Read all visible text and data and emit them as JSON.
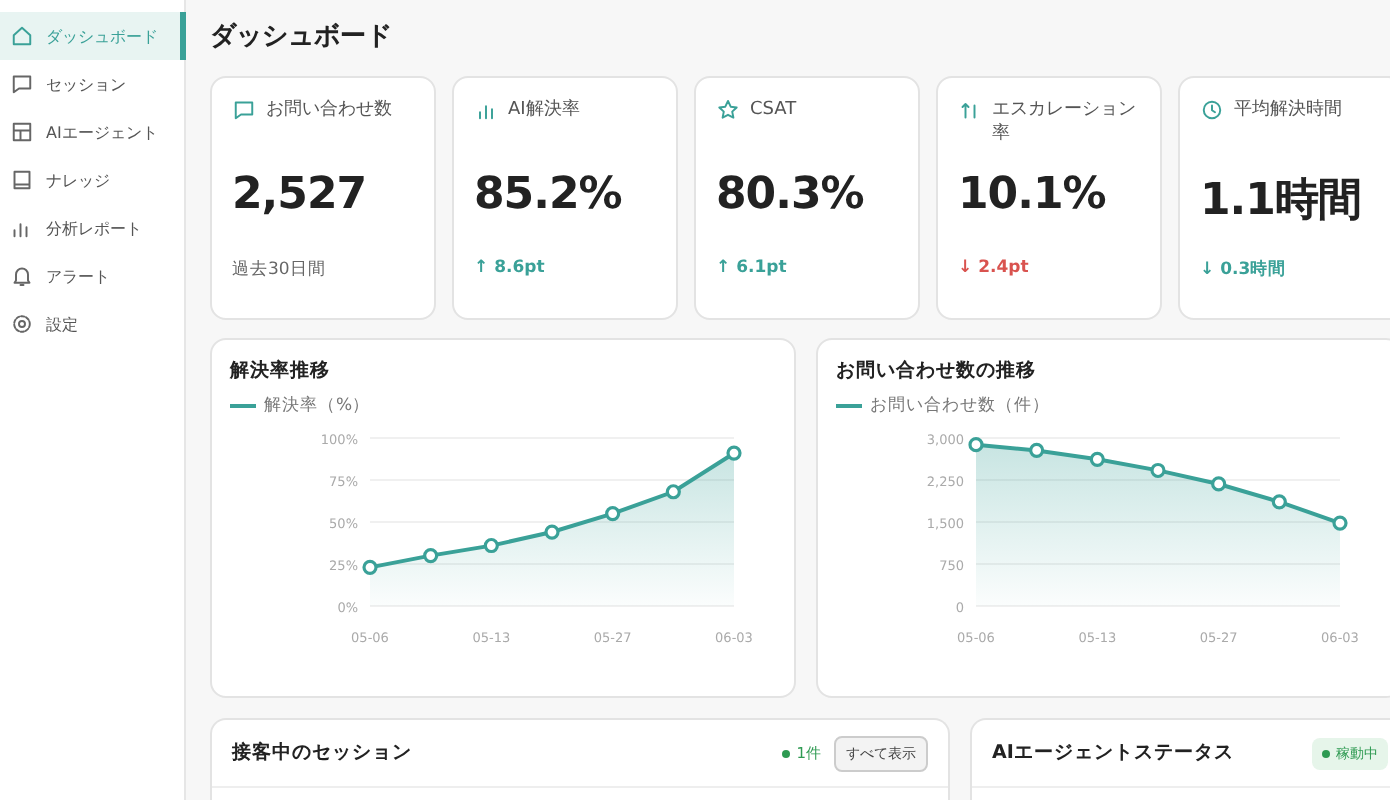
{
  "sidebar": {
    "items": [
      {
        "label": "ダッシュボード",
        "selected": true
      },
      {
        "label": "セッション",
        "selected": false
      },
      {
        "label": "AIエージェント",
        "selected": false
      },
      {
        "label": "ナレッジ",
        "selected": false
      },
      {
        "label": "分析レポート",
        "selected": false
      },
      {
        "label": "アラート",
        "selected": false
      },
      {
        "label": "設定",
        "selected": false
      }
    ]
  },
  "page_title": "ダッシュボード",
  "kpis": [
    {
      "label": "お問い合わせ数",
      "value": "2,527",
      "kind": "note",
      "footer": "過去30日間"
    },
    {
      "label": "AI解決率",
      "value": "85.2%",
      "kind": "delta",
      "footer": "↑ 8.6pt",
      "color": "#3aa198"
    },
    {
      "label": "CSAT",
      "value": "80.3%",
      "kind": "delta",
      "footer": "↑ 6.1pt",
      "color": "#3aa198"
    },
    {
      "label": "エスカレーション率",
      "value": "10.1%",
      "kind": "delta",
      "footer": "↓ 2.4pt",
      "color": "#d9534f"
    },
    {
      "label": "平均解決時間",
      "value": "1.1時間",
      "kind": "delta",
      "footer": "↓ 0.3時間",
      "color": "#3aa198"
    }
  ],
  "charts": [
    {
      "title": "解決率推移",
      "chart_data": {
        "type": "area",
        "grid": true,
        "categories": [
          "05-06",
          null,
          "05-13",
          null,
          "05-27",
          null,
          "06-03"
        ],
        "series": [
          {
            "name": "解決率（%）",
            "color": "#3aa198",
            "values": [
              23,
              30,
              36,
              44,
              55,
              68,
              91
            ]
          }
        ],
        "ylim": [
          0,
          100
        ],
        "yticks": [
          {
            "value": 0,
            "label": "0%"
          },
          {
            "value": 25,
            "label": "25%"
          },
          {
            "value": 50,
            "label": "50%"
          },
          {
            "value": 75,
            "label": "75%"
          },
          {
            "value": 100,
            "label": "100%"
          }
        ]
      }
    },
    {
      "title": "お問い合わせ数の推移",
      "chart_data": {
        "type": "area",
        "grid": true,
        "categories": [
          "05-06",
          null,
          "05-13",
          null,
          "05-27",
          null,
          "06-03"
        ],
        "series": [
          {
            "name": "お問い合わせ数（件）",
            "color": "#3aa198",
            "values": [
              2880,
              2780,
              2620,
              2420,
              2180,
              1860,
              1480
            ]
          }
        ],
        "ylim": [
          0,
          3000
        ],
        "yticks": [
          {
            "value": 0,
            "label": "0"
          },
          {
            "value": 750,
            "label": "750"
          },
          {
            "value": 1500,
            "label": "1,500"
          },
          {
            "value": 2250,
            "label": "2,250"
          },
          {
            "value": 3000,
            "label": "3,000"
          }
        ]
      }
    }
  ],
  "sessions": {
    "title": "接客中のセッション",
    "count": "1件",
    "button": "すべて表示"
  },
  "agent_status": {
    "title": "AIエージェントステータス",
    "badge": "稼動中"
  }
}
